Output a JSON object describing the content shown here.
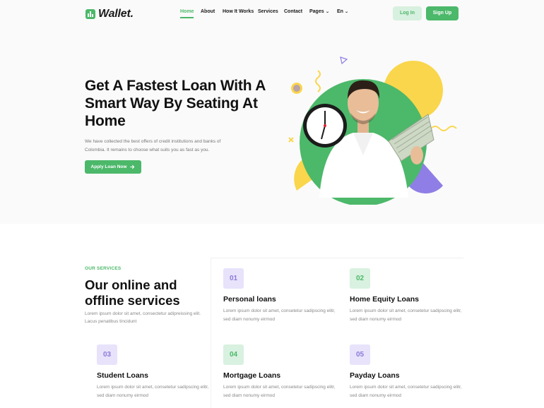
{
  "brand": {
    "name": "Wallet.",
    "accent": "#4cb86a",
    "purple": "#8b7bd8",
    "yellow": "#f9d64b"
  },
  "nav": {
    "items": [
      {
        "label": "Home",
        "active": true
      },
      {
        "label": "About"
      },
      {
        "label": "How It Works"
      },
      {
        "label": "Services"
      },
      {
        "label": "Contact"
      },
      {
        "label": "Pages",
        "dropdown": true
      },
      {
        "label": "En",
        "dropdown": true
      }
    ],
    "login_label": "Log In",
    "signup_label": "Sign Up"
  },
  "hero": {
    "title": "Get A Fastest Loan With A Smart Way By Seating At Home",
    "description": "We have collected the best offers of credit institutions and banks of Colombia. It remains to choose what suits you as fast as you.",
    "cta_label": "Apply Loan Now",
    "cta_icon": "arrow-right-icon"
  },
  "services": {
    "kicker": "OUR SERVICES",
    "heading": "Our online and offline services",
    "subtitle": "Lorem ipsum dolor sit amet, consectetur adipreissing elit. Lacus penatibus tincidunt",
    "cards": [
      {
        "number": "01",
        "title": "Personal loans",
        "desc": "Lorem ipsum dolor sit amet, consetetur sadipscing elitr, sed diam nonumy eirmod",
        "color": "purple"
      },
      {
        "number": "02",
        "title": "Home Equity Loans",
        "desc": "Lorem ipsum dolor sit amet, consetetur sadipscing elitr, sed diam nonumy eirmod",
        "color": "green"
      },
      {
        "number": "03",
        "title": "Student Loans",
        "desc": "Lorem ipsum dolor sit amet, consetetur sadipscing elitr, sed diam nonumy eirmod",
        "color": "purple"
      },
      {
        "number": "04",
        "title": "Mortgage Loans",
        "desc": "Lorem ipsum dolor sit amet, consetetur sadipscing elitr, sed diam nonumy eirmod",
        "color": "green"
      },
      {
        "number": "05",
        "title": "Payday Loans",
        "desc": "Lorem ipsum dolor sit amet, consetetur sadipscing elitr, sed diam nonumy eirmod",
        "color": "purple"
      }
    ]
  }
}
